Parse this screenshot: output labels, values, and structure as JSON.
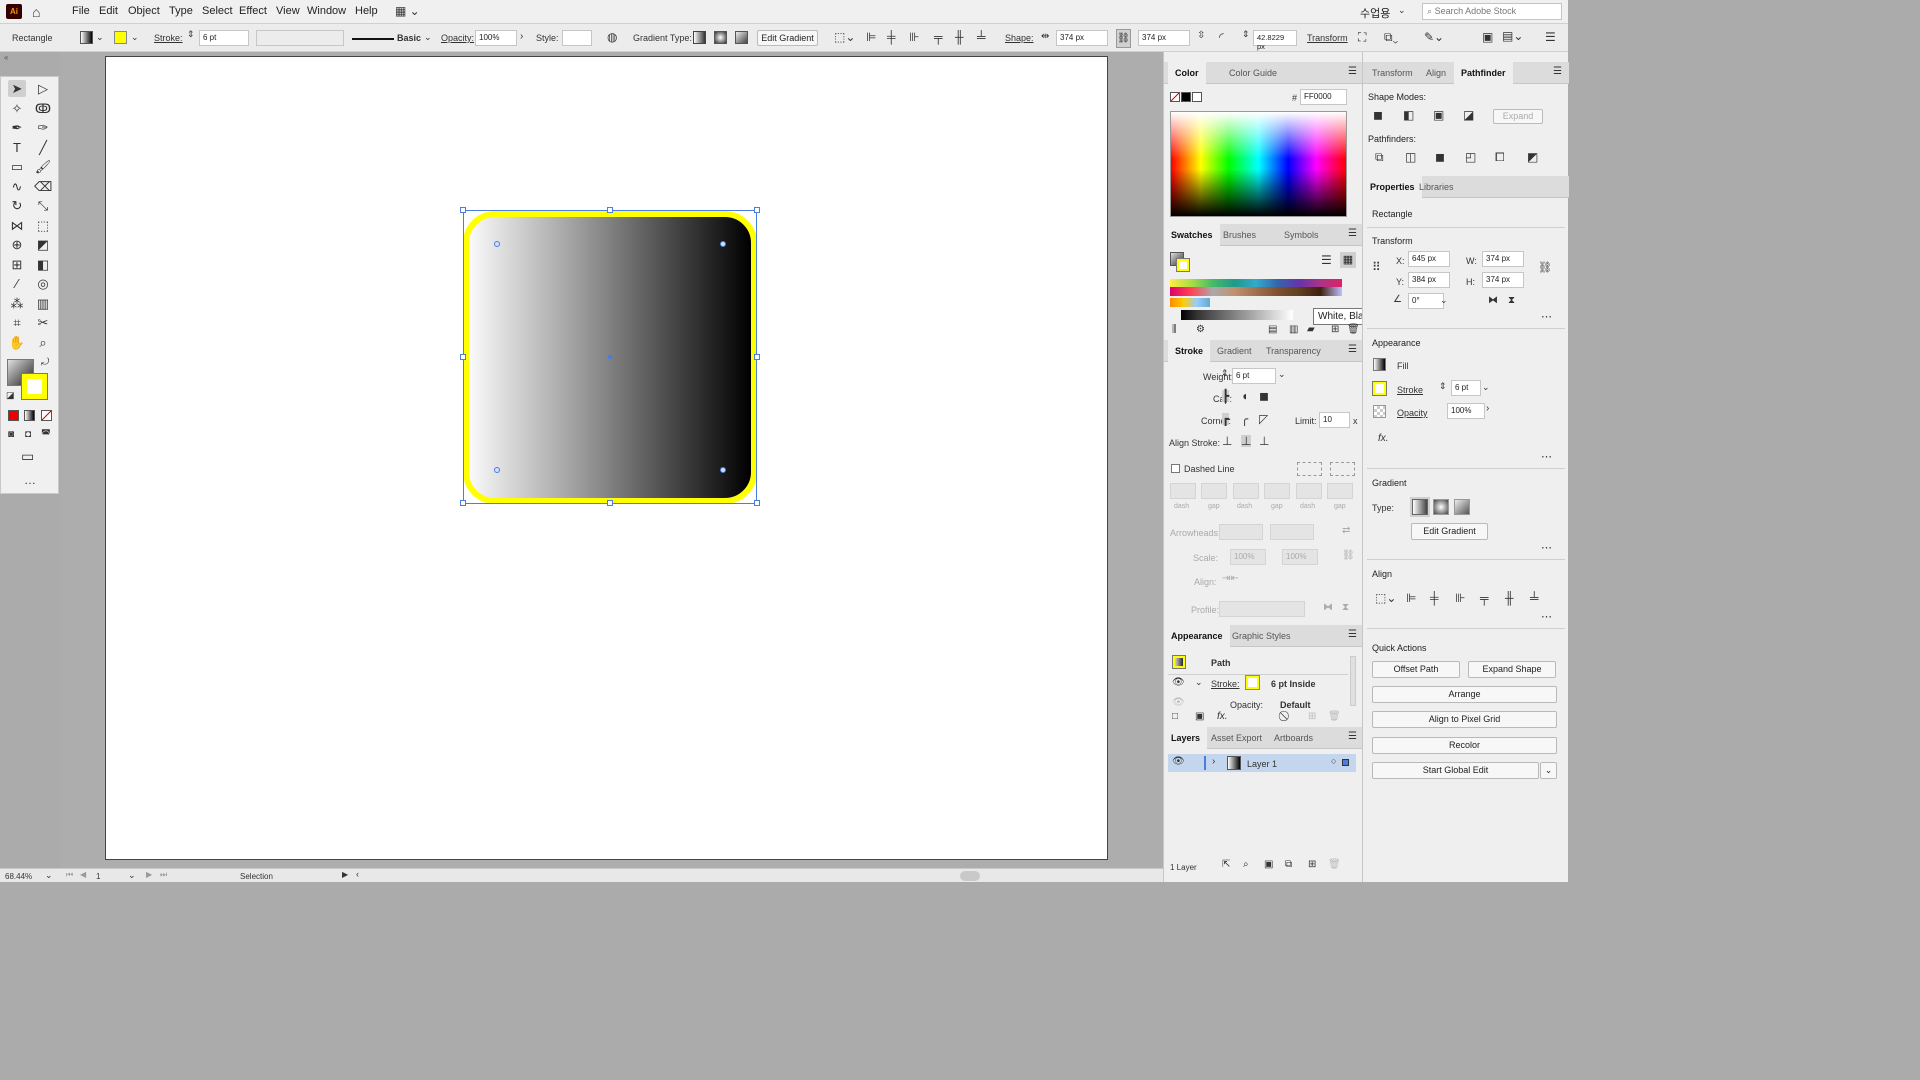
{
  "app": {
    "logo": "Ai"
  },
  "menu": [
    "File",
    "Edit",
    "Object",
    "Type",
    "Select",
    "Effect",
    "View",
    "Window",
    "Help"
  ],
  "menubar_right": {
    "lang": "수업용",
    "search_placeholder": "Search Adobe Stock"
  },
  "control": {
    "object_type": "Rectangle",
    "stroke_label": "Stroke:",
    "stroke_value": "6 pt",
    "brush": "Basic",
    "opacity_label": "Opacity:",
    "opacity_value": "100%",
    "style_label": "Style:",
    "gradient_type_label": "Gradient Type:",
    "edit_gradient": "Edit Gradient",
    "shape_label": "Shape:",
    "width": "374 px",
    "height": "374 px",
    "corner": "42.8229 px",
    "transform": "Transform"
  },
  "color_panel": {
    "tabs": [
      "Color",
      "Color Guide"
    ],
    "hash": "#",
    "hex": "FF0000"
  },
  "swatches_panel": {
    "tabs": [
      "Swatches",
      "Brushes",
      "Symbols"
    ],
    "tooltip": "White, Black"
  },
  "stroke_panel": {
    "tabs": [
      "Stroke",
      "Gradient",
      "Transparency"
    ],
    "weight_label": "Weight:",
    "weight": "6 pt",
    "cap_label": "Cap:",
    "corner_label": "Corner:",
    "limit_label": "Limit:",
    "limit": "10",
    "limit_x": "x",
    "align_label": "Align Stroke:",
    "dashed": "Dashed Line",
    "dash_labels": [
      "dash",
      "gap",
      "dash",
      "gap",
      "dash",
      "gap"
    ],
    "arrowheads": "Arrowheads:",
    "scale": "Scale:",
    "scale1": "100%",
    "scale2": "100%",
    "align2": "Align:",
    "profile": "Profile:"
  },
  "appearance_panel": {
    "tabs": [
      "Appearance",
      "Graphic Styles"
    ],
    "path": "Path",
    "stroke_label": "Stroke:",
    "stroke_value": "6 pt  Inside",
    "opacity_label": "Opacity:",
    "opacity_value": "Default"
  },
  "layers_panel": {
    "tabs": [
      "Layers",
      "Asset Export",
      "Artboards"
    ],
    "layer_name": "Layer 1",
    "count": "1 Layer"
  },
  "right_tabs": [
    "Transform",
    "Align",
    "Pathfinder"
  ],
  "pathfinder": {
    "shape_modes": "Shape Modes:",
    "expand": "Expand",
    "pathfinders": "Pathfinders:"
  },
  "props_tabs": [
    "Properties",
    "Libraries"
  ],
  "properties": {
    "object": "Rectangle",
    "transform_title": "Transform",
    "x_label": "X:",
    "x": "645 px",
    "y_label": "Y:",
    "y": "384 px",
    "w_label": "W:",
    "w": "374 px",
    "h_label": "H:",
    "h": "374 px",
    "angle": "0°",
    "appearance_title": "Appearance",
    "fill": "Fill",
    "stroke": "Stroke",
    "stroke_value": "6 pt",
    "opacity": "Opacity",
    "opacity_value": "100%",
    "fx": "fx.",
    "gradient_title": "Gradient",
    "type_label": "Type:",
    "edit_gradient": "Edit Gradient",
    "align_title": "Align",
    "quick_actions": "Quick Actions",
    "offset_path": "Offset Path",
    "expand_shape": "Expand Shape",
    "arrange": "Arrange",
    "align_pixel": "Align to Pixel Grid",
    "recolor": "Recolor",
    "global_edit": "Start Global Edit"
  },
  "status": {
    "zoom": "68.44%",
    "page": "1",
    "tool": "Selection"
  },
  "colors": {
    "fill_stroke": "#ffff00",
    "accent": "#4a7de0"
  }
}
